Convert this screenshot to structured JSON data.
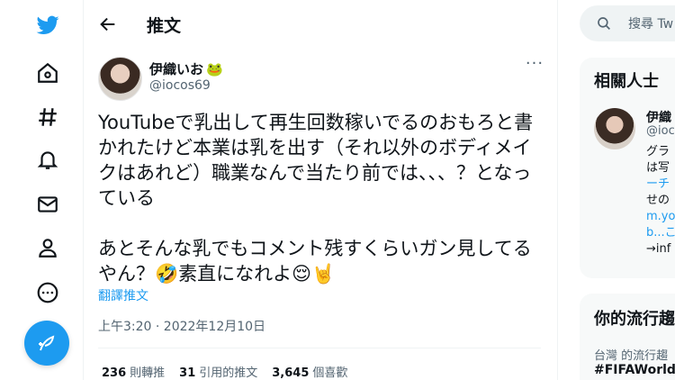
{
  "colors": {
    "accent": "#1d9bf0",
    "text": "#0f1419",
    "muted": "#536471"
  },
  "nav": {
    "logo": "twitter-bird-icon",
    "items": [
      "home-icon",
      "explore-hashtag-icon",
      "notifications-bell-icon",
      "messages-envelope-icon",
      "profile-person-icon",
      "more-circle-icon"
    ],
    "compose": "compose-feather-icon"
  },
  "header": {
    "title": "推文",
    "back_icon": "back-arrow-icon"
  },
  "tweet": {
    "author_name": "伊織いお",
    "author_emoji": "🐸",
    "handle": "@iocos69",
    "more_icon": "more-dots-icon",
    "text": "YouTubeで乳出して再生回数稼いでるのおもろと書かれたけど本業は乳を出す（それ以外のボディメイクはあれど）職業なんで当たり前では、、、？となっている\n\nあとそんな乳でもコメント残すくらいガン見してるやん？🤣素直になれよ😌🤘",
    "translate": "翻譯推文",
    "timestamp": "上午3:20 · 2022年12月10日",
    "stats": {
      "retweets_count": "236",
      "retweets_label": "則轉推",
      "quotes_count": "31",
      "quotes_label": "引用的推文",
      "likes_count": "3,645",
      "likes_label": "個喜歡"
    }
  },
  "sidebar": {
    "search_placeholder": "搜尋 Tw",
    "related": {
      "title": "相關人士",
      "name": "伊織",
      "handle": "@ioc",
      "bio_lines": [
        "グラ",
        "は写",
        "ーチ",
        "せの",
        "m.yo",
        "b...こ",
        "→inf"
      ]
    },
    "trends": {
      "title": "你的流行趨",
      "meta": "台灣 的流行趨",
      "name": "#FIFAWorldC"
    }
  }
}
